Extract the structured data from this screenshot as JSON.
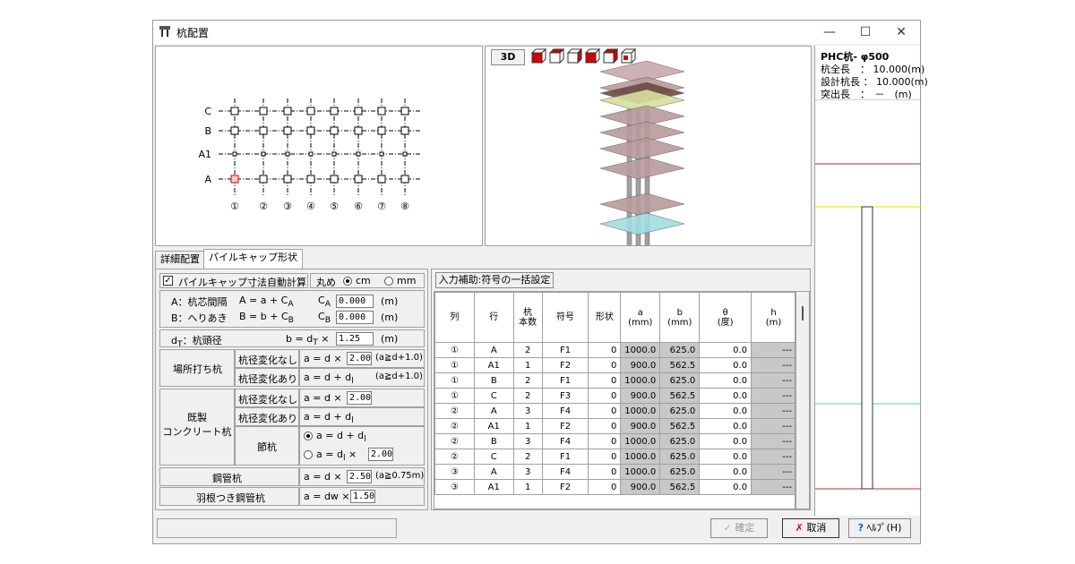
{
  "window": {
    "title": "杭配置",
    "minimize": "—",
    "maximize": "☐",
    "close": "✕"
  },
  "plan": {
    "row_labels": [
      "C",
      "B",
      "A1",
      "A"
    ],
    "col_labels": [
      "①",
      "②",
      "③",
      "④",
      "⑤",
      "⑥",
      "⑦",
      "⑧"
    ]
  },
  "view3d": {
    "button_3d": "3D"
  },
  "tabs": {
    "detail": "詳細配置",
    "pilecap": "パイルキャップ形状"
  },
  "pilecap": {
    "auto_calc_label": "パイルキャップ寸法自動計算",
    "rounding_label": "丸め",
    "unit_cm": "cm",
    "unit_mm": "mm",
    "a_desc": "A：杭芯間隔",
    "a_formula_pre": "A = a + C",
    "a_formula_sub": "A",
    "b_desc": "B：へりあき",
    "b_formula_pre": "B = b + C",
    "b_formula_sub": "B",
    "ca_label": "C",
    "ca_sub": "A",
    "ca_value": "0.000",
    "cb_label": "C",
    "cb_sub": "B",
    "cb_value": "0.000",
    "unit_m": "(m)",
    "dt_desc_pre": "d",
    "dt_desc_sub": "T",
    "dt_desc_post": "：杭頭径",
    "b_eq_pre": "b = d",
    "b_eq_sub": "T",
    "b_eq_post": " ×",
    "dt_value": "1.25",
    "cast_in_place": "場所打ち杭",
    "no_change": "杭径変化なし",
    "with_change": "杭径変化あり",
    "f_ad_times": "a = d ×",
    "cast_nc_value": "2.00",
    "cast_nc_cond": "(a≧d+1.0)",
    "f_ad_plus_pre": "a = d + d",
    "f_ad_plus_sub": "l",
    "cast_wc_cond": "(a≧d+1.0)",
    "precast": "既製\nコンクリート杭",
    "precast_nc_value": "2.00",
    "joint_pile": "節杭",
    "joint_r1_pre": "a = d + d",
    "joint_r1_sub": "l",
    "joint_r2_pre": "a = d",
    "joint_r2_sub": "l",
    "joint_r2_post": " ×",
    "joint_value": "2.00",
    "steel_pipe": "鋼管杭",
    "steel_value": "2.50",
    "steel_cond": "(a≧0.75m)",
    "winged_pipe": "羽根つき鋼管杭",
    "winged_formula": "a = dw ×",
    "winged_value": "1.50"
  },
  "table": {
    "bulk_button": "入力補助:符号の一括設定",
    "headers": [
      "列",
      "行",
      "杭\n本数",
      "符号",
      "形状",
      "a\n(mm)",
      "b\n(mm)",
      "θ\n(度)",
      "h\n(m)"
    ],
    "rows": [
      [
        "①",
        "A",
        "2",
        "F1",
        "0",
        "1000.0",
        "625.0",
        "0.0",
        "---"
      ],
      [
        "①",
        "A1",
        "1",
        "F2",
        "0",
        "900.0",
        "562.5",
        "0.0",
        "---"
      ],
      [
        "①",
        "B",
        "2",
        "F1",
        "0",
        "1000.0",
        "625.0",
        "0.0",
        "---"
      ],
      [
        "①",
        "C",
        "2",
        "F3",
        "0",
        "900.0",
        "562.5",
        "0.0",
        "---"
      ],
      [
        "②",
        "A",
        "3",
        "F4",
        "0",
        "1000.0",
        "625.0",
        "0.0",
        "---"
      ],
      [
        "②",
        "A1",
        "1",
        "F2",
        "0",
        "900.0",
        "562.5",
        "0.0",
        "---"
      ],
      [
        "②",
        "B",
        "3",
        "F4",
        "0",
        "1000.0",
        "625.0",
        "0.0",
        "---"
      ],
      [
        "②",
        "C",
        "2",
        "F1",
        "0",
        "1000.0",
        "625.0",
        "0.0",
        "---"
      ],
      [
        "③",
        "A",
        "3",
        "F4",
        "0",
        "1000.0",
        "625.0",
        "0.0",
        "---"
      ],
      [
        "③",
        "A1",
        "1",
        "F2",
        "0",
        "900.0",
        "562.5",
        "0.0",
        "---"
      ]
    ]
  },
  "sidebar": {
    "pile_name": "PHC杭- φ500",
    "total_len": "杭全長　： 10.000(m)",
    "design_len": "設計杭長 ： 10.000(m)",
    "protrusion": "突出長　：　－　(m)"
  },
  "footer": {
    "confirm": "確定",
    "cancel": "取消",
    "help": "ﾍﾙﾌﾟ(H)"
  }
}
